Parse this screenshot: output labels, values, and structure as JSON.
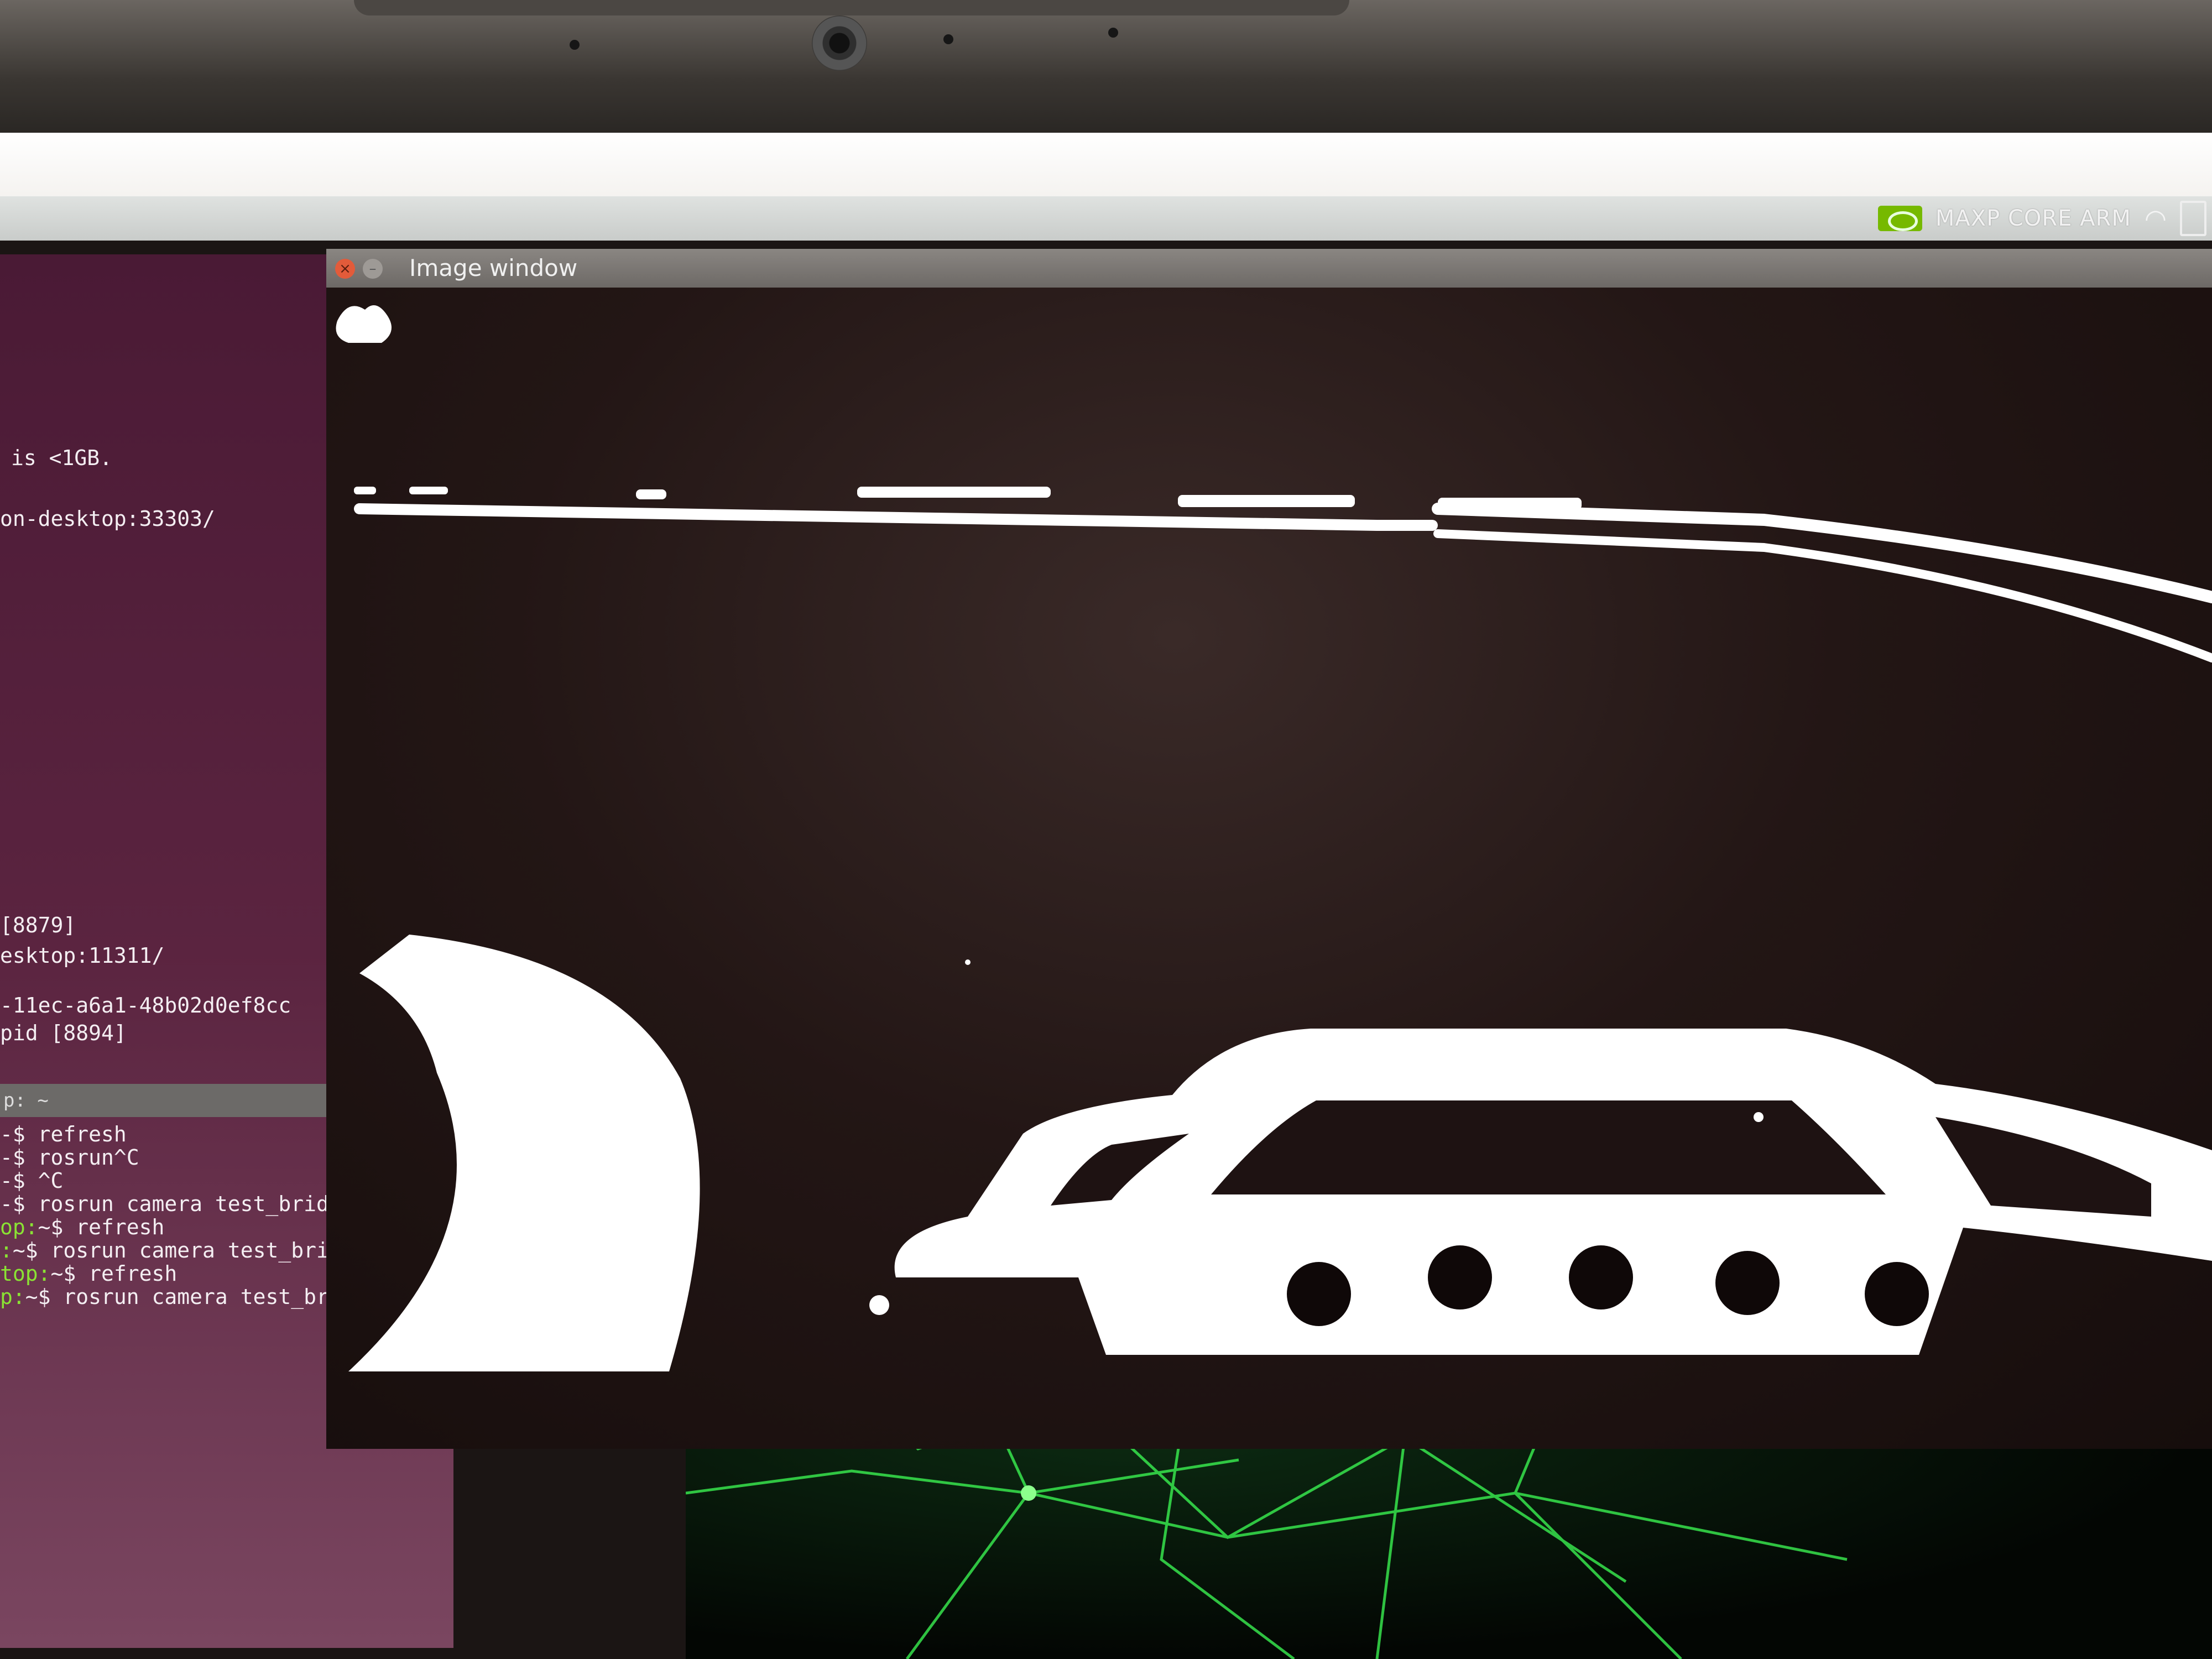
{
  "top_panel": {
    "power_mode": "MAXP CORE ARM",
    "icons": [
      "nvidia-icon",
      "wifi-icon"
    ]
  },
  "terminal": {
    "lines": [
      "is <1GB.",
      "on-desktop:33303/",
      "[8879]",
      "esktop:11311/",
      "-11ec-a6a1-48b02d0ef8cc",
      "pid [8894]"
    ],
    "second_title": "p: ~",
    "second_lines": [
      {
        "prompt": "",
        "cmd": "-$ refresh"
      },
      {
        "prompt": "",
        "cmd": "-$ rosrun^C"
      },
      {
        "prompt": "",
        "cmd": "-$ ^C"
      },
      {
        "prompt": "",
        "cmd": "-$ rosrun camera test_bridge.py"
      },
      {
        "prompt": "op:",
        "cmd": "~$ refresh"
      },
      {
        "prompt": ":",
        "cmd": "~$ rosrun camera test_bridge.py"
      },
      {
        "prompt": "top:",
        "cmd": "~$ refresh"
      },
      {
        "prompt": "p:",
        "cmd": "~$ rosrun camera test_bridge.py"
      }
    ]
  },
  "image_window": {
    "title": "Image window",
    "close_glyph": "×",
    "min_glyph": "–"
  },
  "colors": {
    "nvidia_green": "#76b900",
    "terminal_bg": "#4a1a35",
    "mask_white": "#ffffff"
  }
}
